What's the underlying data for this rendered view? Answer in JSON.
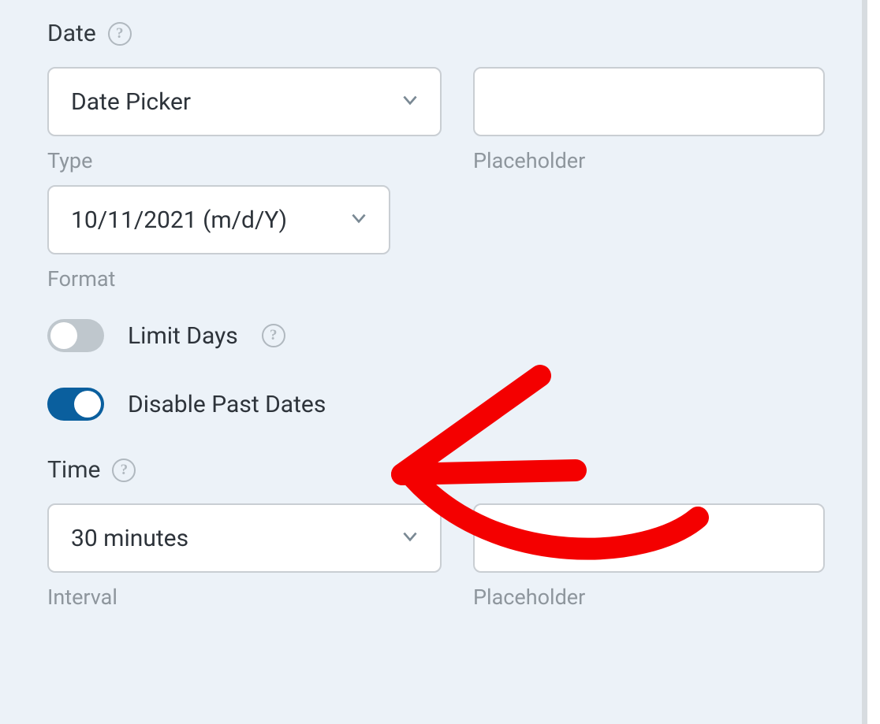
{
  "date": {
    "section_label": "Date",
    "type_select_value": "Date Picker",
    "type_sublabel": "Type",
    "placeholder_value": "",
    "placeholder_sublabel": "Placeholder",
    "format_select_value": "10/11/2021 (m/d/Y)",
    "format_sublabel": "Format"
  },
  "toggles": {
    "limit_days": {
      "label": "Limit Days",
      "enabled": false
    },
    "disable_past": {
      "label": "Disable Past Dates",
      "enabled": true
    }
  },
  "time": {
    "section_label": "Time",
    "interval_select_value": "30 minutes",
    "interval_sublabel": "Interval",
    "placeholder_value": "",
    "placeholder_sublabel": "Placeholder"
  },
  "colors": {
    "annotation_red": "#f40000"
  }
}
